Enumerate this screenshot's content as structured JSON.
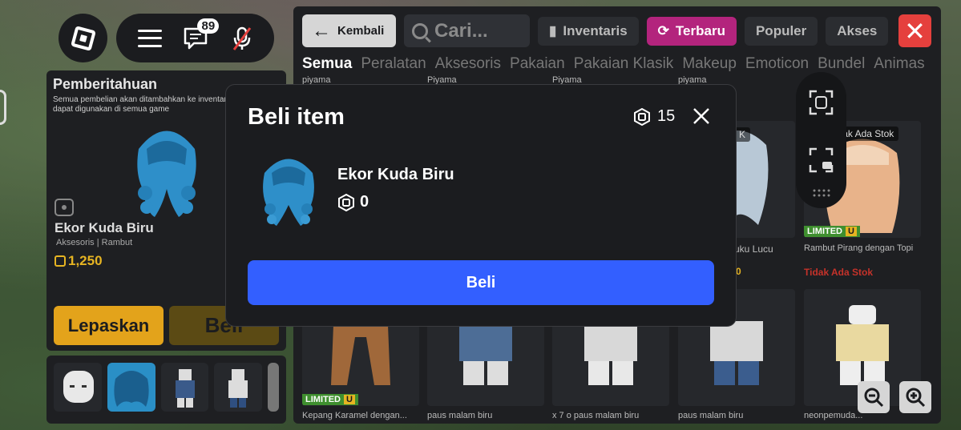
{
  "hud": {
    "chat_badge_count": "89"
  },
  "left_panel": {
    "notification_title": "Pemberitahuan",
    "notification_text": "Semua pembelian akan ditambahkan ke inventaris Anda & dapat digunakan di semua game",
    "item_name": "Ekor Kuda Biru",
    "item_category": "Aksesoris | Rambut",
    "item_price": "1,250",
    "unequip_label": "Lepaskan",
    "buy_label": "Beli"
  },
  "catalog": {
    "back_label": "Kembali",
    "search_placeholder": "Cari...",
    "top_tabs": [
      {
        "label": "Inventaris",
        "icon": "backpack-icon"
      },
      {
        "label": "Terbaru",
        "icon": "refresh-icon",
        "active": true
      },
      {
        "label": "Populer"
      },
      {
        "label": "Akses"
      }
    ],
    "categories": [
      "Semua",
      "Peralatan",
      "Aksesoris",
      "Pakaian",
      "Pakaian Klasik",
      "Makeup",
      "Emoticon",
      "Bundel",
      "Animas"
    ],
    "active_category": "Semua",
    "top_row_captions": [
      "piyama",
      "Piyama",
      "Piyama",
      "piyama"
    ],
    "cards": [
      {
        "name": "...uku Lucu",
        "price": "0"
      },
      {
        "name": "Rambut Pirang dengan Topi",
        "stock_tag": "Tidak Ada Stok",
        "status": "Tidak Ada Stok",
        "limited": "LIMITED",
        "limited_u": "U"
      },
      {
        "name": "Kepang Karamel dengan...",
        "limited": "LIMITED",
        "limited_u": "U"
      },
      {
        "name": "paus malam biru"
      },
      {
        "name": "x 7 o paus malam biru"
      },
      {
        "name": "paus malam biru"
      },
      {
        "name": "neonpemuda..."
      }
    ],
    "stock_tag_partial": "K"
  },
  "modal": {
    "title": "Beli item",
    "balance": "15",
    "item_name": "Ekor Kuda Biru",
    "item_price": "0",
    "buy_label": "Beli"
  },
  "colors": {
    "buy_blue": "#335fff",
    "unequip_gold": "#e3a31b",
    "close_red": "#e5403d",
    "active_tab_magenta": "#b3247d"
  }
}
